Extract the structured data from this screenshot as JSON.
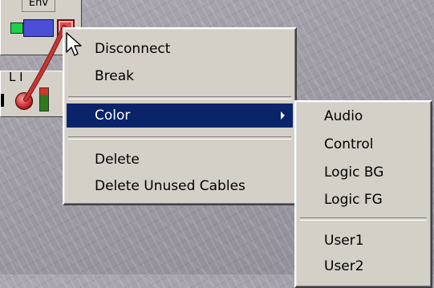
{
  "modules": {
    "env_title": "Env",
    "level_label": "L I"
  },
  "context_menu": {
    "items": [
      "Disconnect",
      "Break",
      "Color",
      "Delete",
      "Delete Unused Cables"
    ],
    "highlighted": "Color",
    "highlight_color": "#0a246a"
  },
  "color_submenu": {
    "items": [
      "Audio",
      "Control",
      "Logic BG",
      "Logic FG",
      "User1",
      "User2"
    ]
  },
  "cursor": {
    "icon": "arrow-pointer-icon"
  },
  "colors": {
    "cable": "#c73535",
    "menu_bg": "#d4d0c8"
  }
}
